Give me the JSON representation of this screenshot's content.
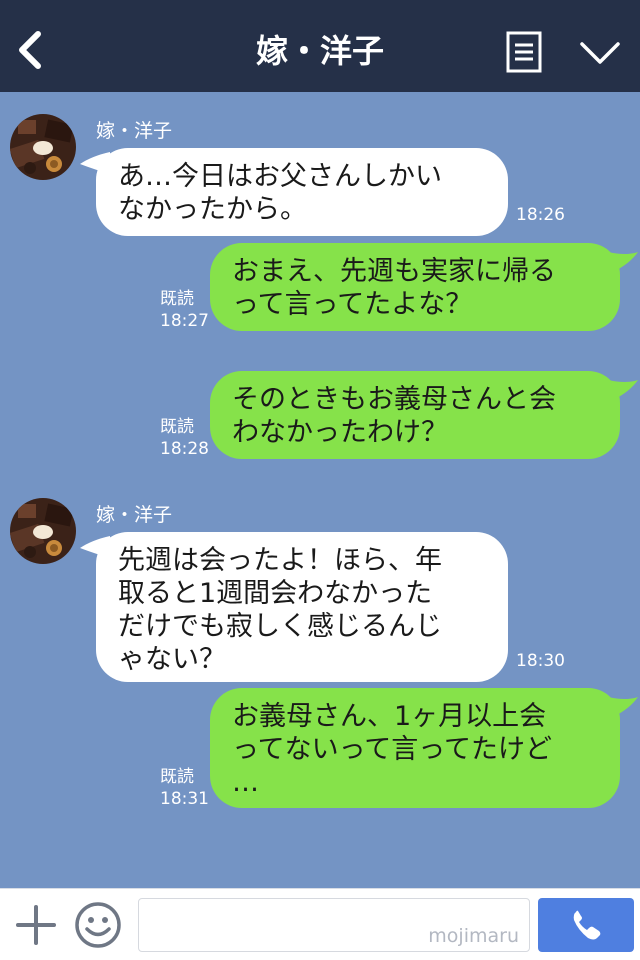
{
  "header": {
    "title": "嫁・洋子"
  },
  "messages": [
    {
      "sender": "嫁・洋子",
      "lines": [
        "あ…今日はお父さんしかい",
        "なかったから。"
      ],
      "time": "18:26"
    },
    {
      "lines": [
        "おまえ、先週も実家に帰る",
        "って言ってたよな？"
      ],
      "read": "既読",
      "time": "18:27"
    },
    {
      "lines": [
        "そのときもお義母さんと会",
        "わなかったわけ？"
      ],
      "read": "既読",
      "time": "18:28"
    },
    {
      "sender": "嫁・洋子",
      "lines": [
        "先週は会ったよ！ほら、年",
        "取ると1週間会わなかった",
        "だけでも寂しく感じるんじ",
        "ゃない？"
      ],
      "time": "18:30"
    },
    {
      "lines": [
        "お義母さん、1ヶ月以上会",
        "ってないって言ってたけど",
        "…"
      ],
      "read": "既読",
      "time": "18:31"
    }
  ],
  "footer": {
    "watermark": "mojimaru"
  },
  "icons": {
    "back": "chevron-left-icon",
    "menu": "note-icon",
    "expand": "chevron-down-icon",
    "add": "plus-icon",
    "emoji": "smiley-icon",
    "call": "phone-icon"
  },
  "colors": {
    "header_bg": "#253048",
    "chat_bg": "#7494c4",
    "incoming_bubble": "#ffffff",
    "outgoing_bubble": "#86e24a",
    "call_button": "#4f7fe0"
  }
}
